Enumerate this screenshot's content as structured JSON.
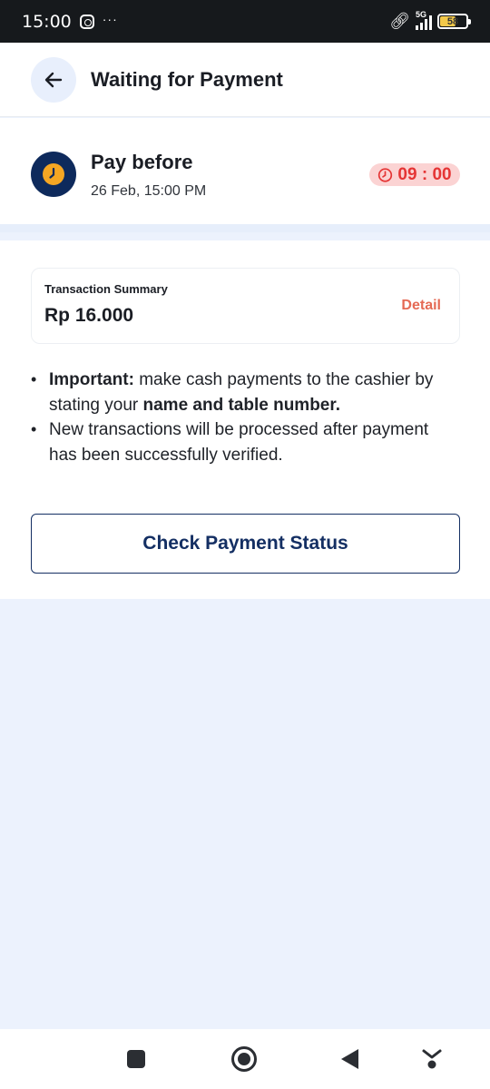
{
  "status_bar": {
    "time": "15:00",
    "more_indicator": "···",
    "network_label": "5G",
    "battery_level": "58"
  },
  "header": {
    "title": "Waiting for Payment",
    "back_icon": "arrow-left-icon"
  },
  "deadline": {
    "label": "Pay before",
    "date": "26 Feb, 15:00 PM",
    "countdown": "09 : 00",
    "clock_color": "#f5a623",
    "timer_color": "#e53535"
  },
  "summary": {
    "label": "Transaction Summary",
    "amount": "Rp 16.000",
    "detail_label": "Detail"
  },
  "notes": {
    "note1": {
      "bold_prefix": "Important:",
      "text_mid": " make cash payments to the cashier by stating your ",
      "bold_suffix": "name and table number."
    },
    "note2": {
      "text": "New transactions will be processed after payment has been successfully verified."
    }
  },
  "actions": {
    "check_status_label": "Check Payment Status"
  },
  "colors": {
    "primary": "#142f63",
    "accent_link": "#e56a55",
    "background": "#ecf2fd"
  }
}
